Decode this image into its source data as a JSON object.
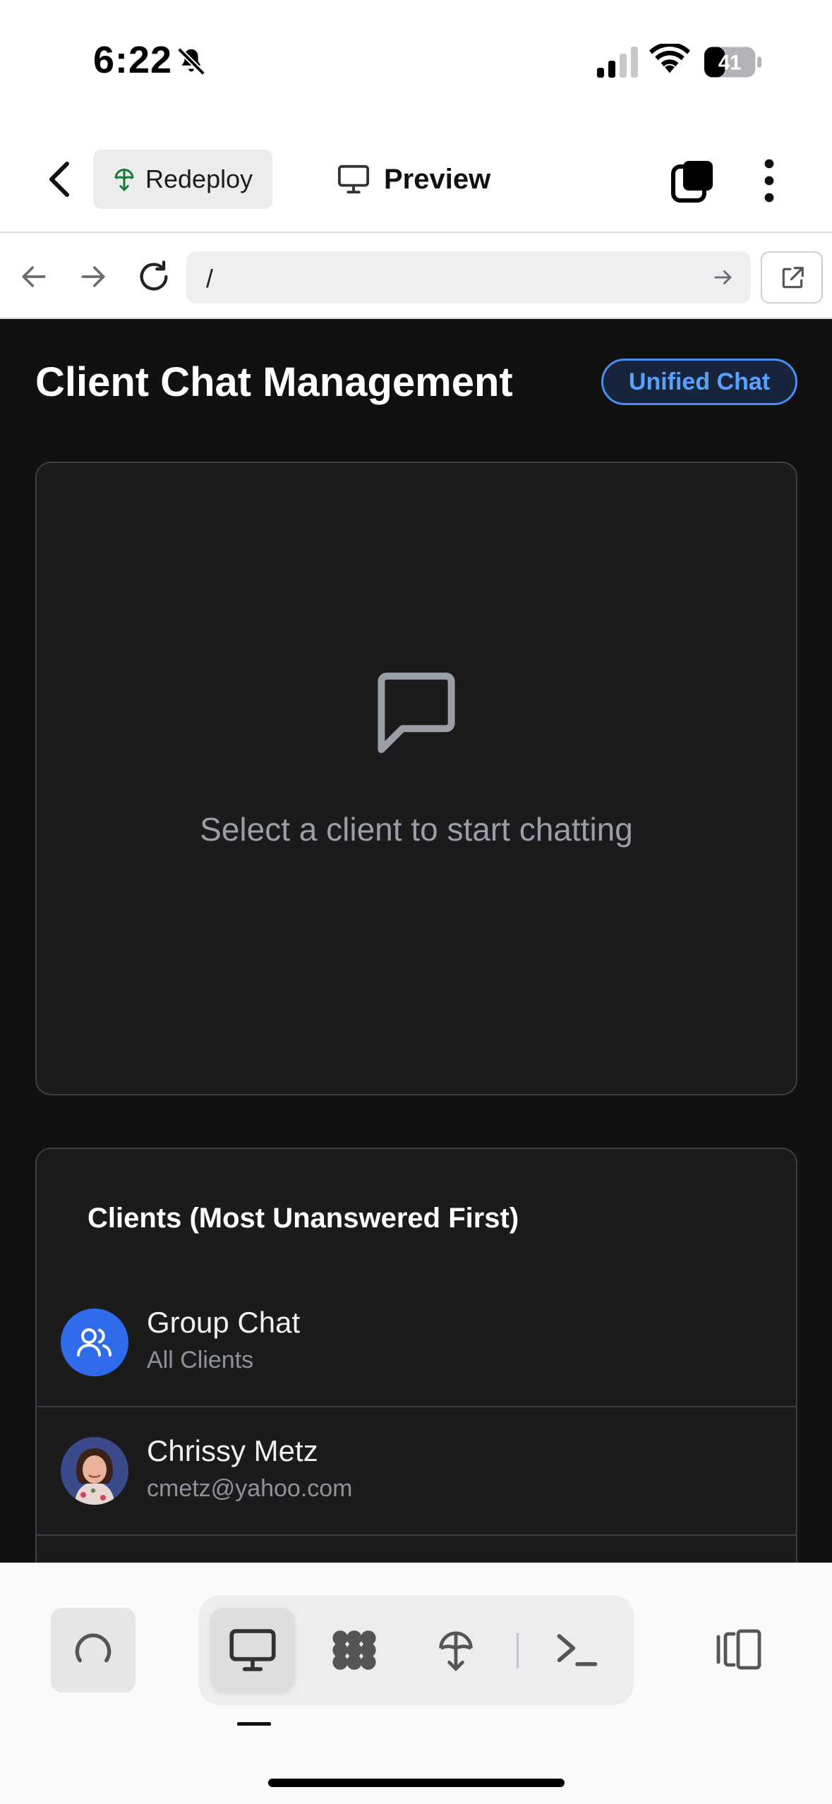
{
  "status_bar": {
    "time": "6:22",
    "battery": "41",
    "icons": [
      "bell-slash-icon",
      "cellular-signal-icon",
      "wifi-icon",
      "battery-icon"
    ]
  },
  "header": {
    "redeploy_label": "Redeploy",
    "preview_label": "Preview",
    "icons": [
      "chevron-left-icon",
      "deploy-icon",
      "monitor-icon",
      "tabs-icon",
      "more-vertical-icon"
    ]
  },
  "browser": {
    "url": "/",
    "icons": [
      "arrow-left-icon",
      "arrow-right-icon",
      "reload-icon",
      "arrow-go-icon",
      "external-link-icon"
    ]
  },
  "page": {
    "title": "Client Chat Management",
    "unified_chat_label": "Unified Chat",
    "chat_empty_text": "Select a client to start chatting",
    "clients_title": "Clients (Most Unanswered First)",
    "clients": [
      {
        "name": "Group Chat",
        "sub": "All Clients",
        "avatar": "group-icon"
      },
      {
        "name": "Chrissy Metz",
        "sub": "cmetz@yahoo.com",
        "avatar": "photo"
      }
    ]
  },
  "toolbar": {
    "icons": [
      "loading-icon",
      "desktop-icon",
      "plugins-icon",
      "deploy-icon",
      "terminal-icon",
      "split-view-icon"
    ],
    "active_tool": "desktop"
  },
  "colors": {
    "page_bg": "#111111",
    "panel_bg": "#1b1b1c",
    "accent_blue": "#4b8df0",
    "group_avatar": "#2f6bea"
  }
}
